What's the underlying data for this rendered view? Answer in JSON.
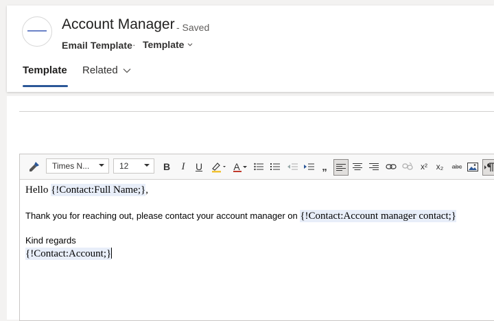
{
  "header": {
    "title": "Account Manager",
    "saved_status": "- Saved",
    "entity_name": "Email Template",
    "separator": "·",
    "form_selector": "Template"
  },
  "tabs": [
    {
      "label": "Template",
      "active": true
    },
    {
      "label": "Related",
      "active": false
    }
  ],
  "toolbar": {
    "font_family": "Times N...",
    "font_size": "12",
    "buttons": [
      "format-painter-icon",
      "bold-icon",
      "italic-icon",
      "underline-icon",
      "highlight-icon",
      "font-color-icon",
      "bullets-icon",
      "numbering-icon",
      "decrease-indent-icon",
      "increase-indent-icon",
      "quote-icon",
      "align-left-icon",
      "align-center-icon",
      "align-right-icon",
      "link-icon",
      "unlink-icon",
      "superscript-icon",
      "subscript-icon",
      "strikethrough-icon",
      "image-icon",
      "ltr-icon"
    ],
    "bold_glyph": "B",
    "italic_glyph": "I",
    "underline_glyph": "U",
    "font_color_glyph": "A",
    "quote_glyph": "„",
    "superscript_glyph": "x²",
    "subscript_glyph": "x₂",
    "strike_glyph": "abc"
  },
  "body": {
    "greeting_prefix": "Hello ",
    "greeting_slug": "{!Contact:Full Name;}",
    "greeting_suffix": ",",
    "message_text": "Thank you for reaching out, please contact your account manager on ",
    "message_slug": "{!Contact:Account manager contact;}",
    "closing": "Kind regards",
    "signature_slug": "{!Contact:Account;}"
  },
  "colors": {
    "accent": "#2b5797",
    "slug_background": "#e8eef9"
  }
}
